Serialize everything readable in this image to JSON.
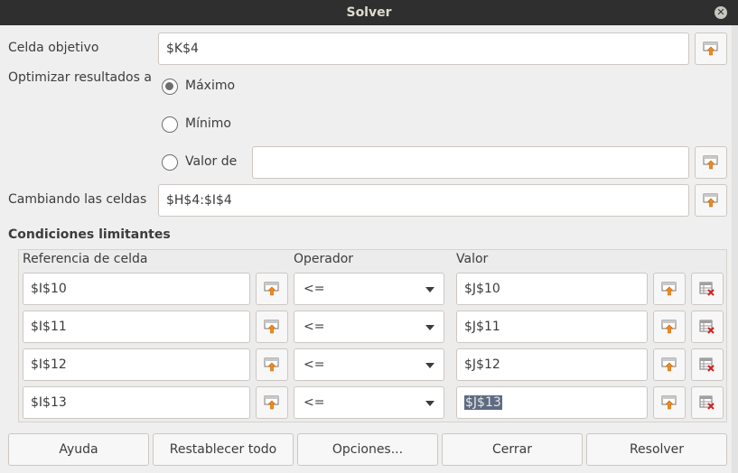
{
  "window": {
    "title": "Solver"
  },
  "target": {
    "label": "Celda objetivo",
    "value": "$K$4"
  },
  "optimize": {
    "label": "Optimizar resultados a",
    "options": [
      {
        "label": "Máximo",
        "checked": true
      },
      {
        "label": "Mínimo",
        "checked": false
      },
      {
        "label": "Valor de",
        "checked": false
      }
    ],
    "value_of": ""
  },
  "changing": {
    "label": "Cambiando las celdas",
    "value": "$H$4:$I$4"
  },
  "constraints": {
    "heading": "Condiciones limitantes",
    "headers": {
      "ref": "Referencia de celda",
      "op": "Operador",
      "val": "Valor"
    },
    "rows": [
      {
        "ref": "$I$10",
        "op": "<=",
        "val": "$J$10"
      },
      {
        "ref": "$I$11",
        "op": "<=",
        "val": "$J$11"
      },
      {
        "ref": "$I$12",
        "op": "<=",
        "val": "$J$12"
      },
      {
        "ref": "$I$13",
        "op": "<=",
        "val": "$J$13"
      }
    ]
  },
  "buttons": {
    "help": "Ayuda",
    "reset": "Restablecer todo",
    "options": "Opciones...",
    "close": "Cerrar",
    "solve": "Resolver"
  },
  "icons": {
    "shrink": "shrink-select-icon",
    "remove": "remove-constraint-icon",
    "close": "close-icon"
  },
  "colors": {
    "titlebar": "#2f2f2f",
    "selection": "#5e6b82"
  }
}
